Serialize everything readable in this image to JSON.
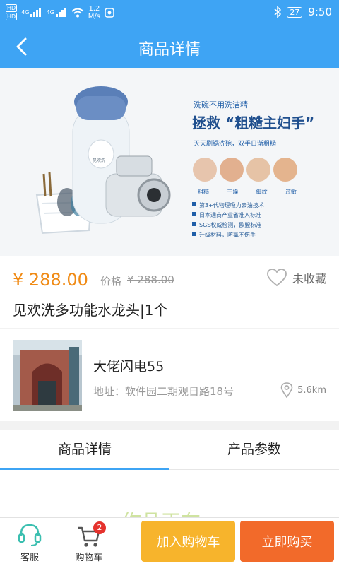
{
  "status": {
    "network_speed": "1.2",
    "network_unit": "M/s",
    "battery": "27",
    "time": "9:50",
    "network_labels": [
      "HD",
      "HD",
      "4G",
      "4G"
    ]
  },
  "header": {
    "title": "商品详情"
  },
  "banner": {
    "tagline": "洗碗不用洗洁精",
    "headline": "拯救 “粗糙主妇手”",
    "subline": "天天刷锅洗碗，双手日渐粗糙",
    "hand_labels": [
      "粗糙",
      "干燥",
      "细纹",
      "过敏"
    ],
    "features": [
      "第3+代物理吸力去油技术",
      "日本通商产业省准入标准",
      "SGS权威检测，欧盟标准",
      "升级材料，防氯不伤手"
    ],
    "brand": "见欢洗"
  },
  "product": {
    "price": "¥ 288.00",
    "orig_label": "价格",
    "orig_price": "¥ 288.00",
    "fav_label": "未收藏",
    "name": "见欢洗多功能水龙头|1个"
  },
  "shop": {
    "name": "大佬闪电55",
    "address": "地址：软件园二期观日路18号",
    "distance": "5.6km"
  },
  "tabs": [
    "商品详情",
    "产品参数"
  ],
  "detail": {
    "partial_text": "作品正在"
  },
  "bottom": {
    "service_label": "客服",
    "cart_label": "购物车",
    "cart_count": "2",
    "add_cart": "加入购物车",
    "buy_now": "立即购买"
  },
  "colors": {
    "primary": "#3ea4f4",
    "accent": "#f08a14",
    "add_button": "#f7b42c",
    "buy_button": "#f26a2a",
    "badge": "#e5322d"
  }
}
